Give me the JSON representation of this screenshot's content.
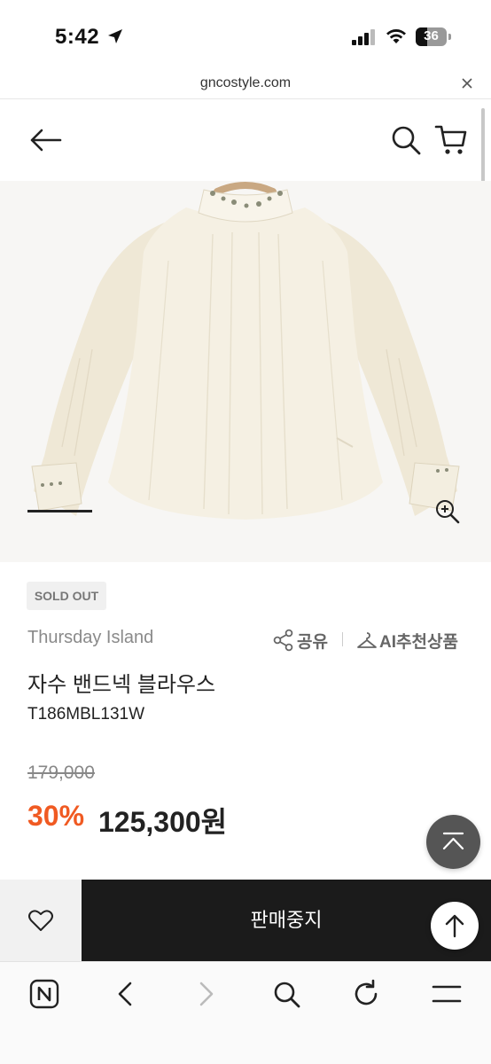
{
  "status_bar": {
    "time": "5:42",
    "battery": "36",
    "battery_level": 0.36
  },
  "browser": {
    "url": "gncostyle.com"
  },
  "product": {
    "badge": "SOLD OUT",
    "brand": "Thursday Island",
    "share_label": "공유",
    "ai_label": "AI추천상품",
    "name": "자수 밴드넥 블라우스",
    "code": "T186MBL131W",
    "original_price": "179,000",
    "discount": "30%",
    "sale_price": "125,300원"
  },
  "actions": {
    "stop_label": "판매중지"
  },
  "colors": {
    "accent_discount": "#f05a22",
    "action_bar": "#1b1b1b"
  },
  "icons": [
    "location-arrow-icon",
    "signal-icon",
    "wifi-icon",
    "battery-icon",
    "close-icon",
    "back-arrow-icon",
    "search-icon",
    "cart-icon",
    "zoom-in-icon",
    "share-icon",
    "hanger-icon",
    "collapse-up-icon",
    "heart-icon",
    "arrow-up-icon",
    "naver-icon",
    "chevron-left-icon",
    "chevron-right-icon",
    "reload-icon",
    "menu-icon"
  ]
}
